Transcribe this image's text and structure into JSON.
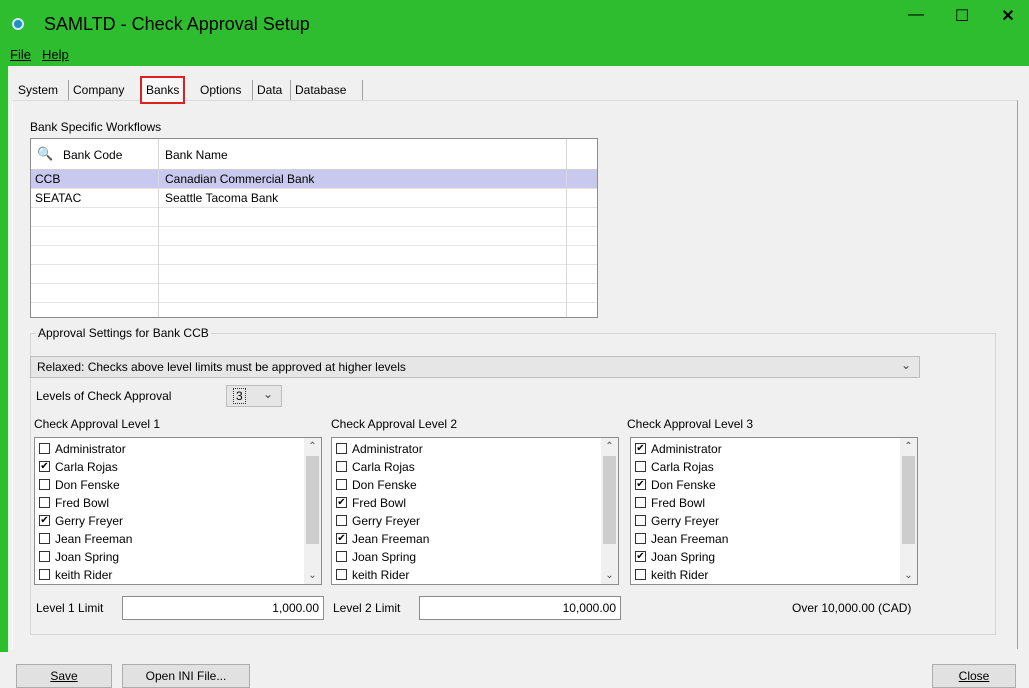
{
  "window": {
    "title": "SAMLTD - Check Approval Setup",
    "controls": {
      "minimize": "—",
      "maximize": "☐",
      "close": "✕"
    }
  },
  "menu": [
    {
      "label": "File"
    },
    {
      "label": "Help"
    }
  ],
  "tabs": [
    {
      "label": "System"
    },
    {
      "label": "Company"
    },
    {
      "label": "Banks",
      "active": true
    },
    {
      "label": "Options"
    },
    {
      "label": "Data"
    },
    {
      "label": "Database"
    }
  ],
  "banks": {
    "section_label": "Bank Specific Workflows",
    "columns": [
      "Bank Code",
      "Bank Name"
    ],
    "rows": [
      {
        "code": "CCB",
        "name": "Canadian Commercial Bank",
        "selected": true
      },
      {
        "code": "SEATAC",
        "name": "Seattle Tacoma Bank"
      }
    ]
  },
  "approval": {
    "group_label": "Approval Settings for Bank CCB",
    "mode": "Relaxed: Checks above level limits must be approved at higher levels",
    "levels_label": "Levels of Check Approval",
    "levels_value": "3",
    "level1": {
      "title": "Check Approval Level 1",
      "items": [
        {
          "name": "Administrator",
          "checked": false
        },
        {
          "name": "Carla Rojas",
          "checked": true
        },
        {
          "name": "Don Fenske",
          "checked": false
        },
        {
          "name": "Fred Bowl",
          "checked": false
        },
        {
          "name": "Gerry Freyer",
          "checked": true
        },
        {
          "name": "Jean Freeman",
          "checked": false
        },
        {
          "name": "Joan Spring",
          "checked": false
        },
        {
          "name": "keith Rider",
          "checked": false
        }
      ],
      "limit_label": "Level 1 Limit",
      "limit_value": "1,000.00"
    },
    "level2": {
      "title": "Check Approval Level 2",
      "items": [
        {
          "name": "Administrator",
          "checked": false
        },
        {
          "name": "Carla Rojas",
          "checked": false
        },
        {
          "name": "Don Fenske",
          "checked": false
        },
        {
          "name": "Fred Bowl",
          "checked": true
        },
        {
          "name": "Gerry Freyer",
          "checked": false
        },
        {
          "name": "Jean Freeman",
          "checked": true
        },
        {
          "name": "Joan Spring",
          "checked": false
        },
        {
          "name": "keith Rider",
          "checked": false
        }
      ],
      "limit_label": "Level 2 Limit",
      "limit_value": "10,000.00"
    },
    "level3": {
      "title": "Check Approval Level 3",
      "items": [
        {
          "name": "Administrator",
          "checked": true
        },
        {
          "name": "Carla Rojas",
          "checked": false
        },
        {
          "name": "Don Fenske",
          "checked": true
        },
        {
          "name": "Fred Bowl",
          "checked": false
        },
        {
          "name": "Gerry Freyer",
          "checked": false
        },
        {
          "name": "Jean Freeman",
          "checked": false
        },
        {
          "name": "Joan Spring",
          "checked": true
        },
        {
          "name": "keith Rider",
          "checked": false
        }
      ],
      "over_label": "Over 10,000.00 (CAD)"
    }
  },
  "buttons": {
    "save": "Save",
    "open_ini": "Open INI File...",
    "close": "Close"
  },
  "colors": {
    "title_bar": "#2ebd2e",
    "selected_row": "#c9c9ef",
    "active_tab_border": "#e0201e"
  }
}
